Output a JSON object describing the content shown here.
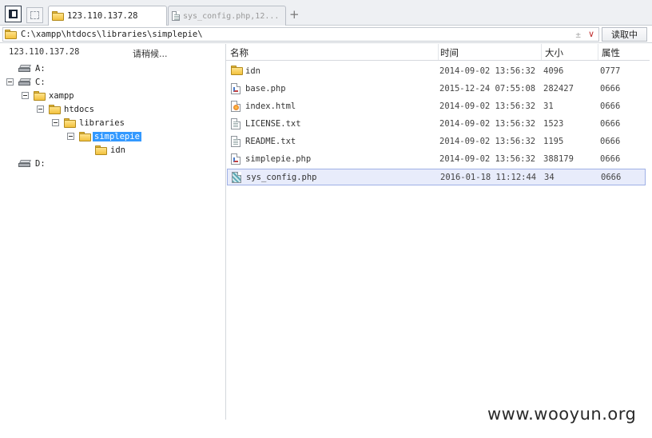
{
  "tabs": {
    "active_label": "123.110.137.28",
    "inactive_label": "sys_config.php,12...",
    "add_label": "+"
  },
  "path_bar": {
    "path": "C:\\xampp\\htdocs\\libraries\\simplepie\\",
    "encoding_glyph": "±",
    "dropdown_glyph": "∨",
    "read_button": "读取中"
  },
  "left_pane": {
    "host": "123.110.137.28",
    "status": "请稍候...",
    "tree": [
      {
        "label": "A:",
        "type": "drive"
      },
      {
        "label": "C:",
        "type": "drive",
        "expanded": true
      },
      {
        "label": "xampp",
        "type": "folder",
        "expanded": true
      },
      {
        "label": "htdocs",
        "type": "folder",
        "expanded": true
      },
      {
        "label": "libraries",
        "type": "folder",
        "expanded": true
      },
      {
        "label": "simplepie",
        "type": "folder",
        "expanded": true,
        "selected": true
      },
      {
        "label": "idn",
        "type": "folder"
      },
      {
        "label": "D:",
        "type": "drive"
      }
    ]
  },
  "file_list": {
    "columns": {
      "name": "名称",
      "time": "时间",
      "size": "大小",
      "attr": "属性"
    },
    "rows": [
      {
        "name": "idn",
        "time": "2014-09-02 13:56:32",
        "size": "4096",
        "attr": "0777",
        "icon": "folder-icon"
      },
      {
        "name": "base.php",
        "time": "2015-12-24 07:55:08",
        "size": "282427",
        "attr": "0666",
        "icon": "php-file-icon"
      },
      {
        "name": "index.html",
        "time": "2014-09-02 13:56:32",
        "size": "31",
        "attr": "0666",
        "icon": "html-file-icon"
      },
      {
        "name": "LICENSE.txt",
        "time": "2014-09-02 13:56:32",
        "size": "1523",
        "attr": "0666",
        "icon": "text-file-icon"
      },
      {
        "name": "README.txt",
        "time": "2014-09-02 13:56:32",
        "size": "1195",
        "attr": "0666",
        "icon": "text-file-icon"
      },
      {
        "name": "simplepie.php",
        "time": "2014-09-02 13:56:32",
        "size": "388179",
        "attr": "0666",
        "icon": "php-file-icon"
      },
      {
        "name": "sys_config.php",
        "time": "2016-01-18 11:12:44",
        "size": "34",
        "attr": "0666",
        "icon": "php-file-icon",
        "selected": true
      }
    ]
  },
  "watermark": "www.wooyun.org"
}
